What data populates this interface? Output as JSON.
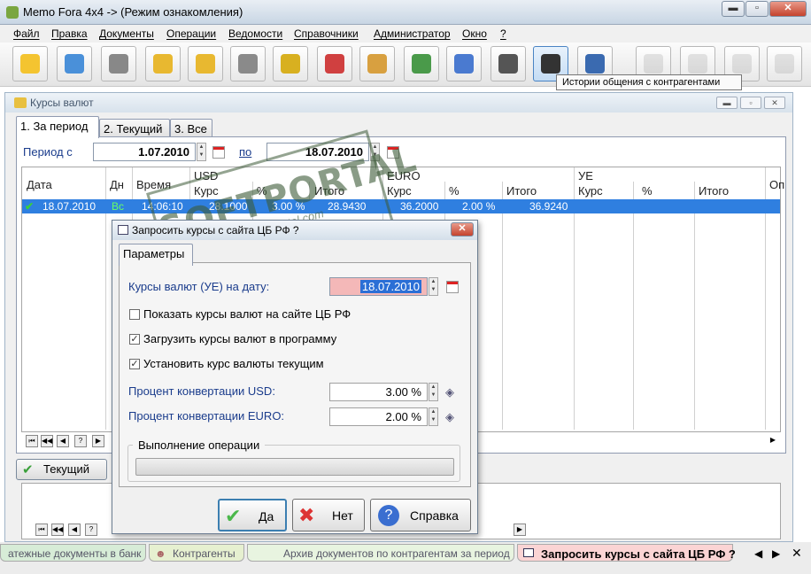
{
  "window": {
    "title": "Memo Fora 4x4 -> (Режим ознакомления)",
    "min": "▬",
    "max": "▫",
    "close": "✕"
  },
  "menu": [
    "Файл",
    "Правка",
    "Документы",
    "Операции",
    "Ведомости",
    "Справочники",
    "Администратор",
    "Окно",
    "?"
  ],
  "toolbar": {
    "icons": [
      "note-pen-icon",
      "card-icon",
      "printer-register-icon",
      "add-folder-icon",
      "import-folder-icon",
      "download-document-icon",
      "forklift-icon",
      "contractors-users-icon",
      "box-icon",
      "presentation-icon",
      "bar-chart-icon",
      "binoculars-icon",
      "headset-icon",
      "phone-note-icon",
      "gray-tool-1-icon",
      "gray-tool-2-icon",
      "gray-tool-3-icon",
      "gray-tool-4-icon"
    ],
    "tooltip": "Истории общения с контрагентами",
    "colors": [
      "#f4c430",
      "#4a90d9",
      "#888888",
      "#e8b830",
      "#e8b830",
      "#8a8a8a",
      "#d8b020",
      "#d04040",
      "#d8a040",
      "#4a9a4a",
      "#4a7ad0",
      "#555555",
      "#333333",
      "#3a6ab0",
      "#999999",
      "#999999",
      "#999999",
      "#999999"
    ]
  },
  "child": {
    "title": "Курсы валют",
    "tabs": [
      "1. За период",
      "2. Текущий",
      "3. Все"
    ],
    "period": {
      "from_label": "Период с",
      "from": "1.07.2010",
      "to_label": "по",
      "to": "18.07.2010"
    },
    "headers": {
      "date": "Дата",
      "day": "Дн",
      "time": "Время",
      "usd": "USD",
      "euro": "EURO",
      "ue": "УЕ",
      "rate": "Курс",
      "pct": "%",
      "total": "Итого",
      "op": "Оп"
    },
    "row": {
      "date": "18.07.2010",
      "day": "Вс",
      "time": "14:06:10",
      "usd_rate": "28.1000",
      "usd_pct": "3.00 %",
      "usd_total": "28.9430",
      "eur_rate": "36.2000",
      "eur_pct": "2.00 %",
      "eur_total": "36.9240"
    },
    "current_button": "Текущий"
  },
  "dialog": {
    "title": "Запросить курсы с сайта ЦБ РФ ?",
    "tab": "Параметры",
    "date_label": "Курсы валют (УЕ) на дату:",
    "date": "18.07.2010",
    "checks": [
      {
        "label": "Показать курсы валют на сайте ЦБ РФ",
        "checked": false
      },
      {
        "label": "Загрузить курсы валют в программу",
        "checked": true
      },
      {
        "label": "Установить курс валюты текущим",
        "checked": true
      }
    ],
    "usd_label": "Процент конвертации USD:",
    "usd_pct": "3.00 %",
    "eur_label": "Процент конвертации EURO:",
    "eur_pct": "2.00 %",
    "progress_label": "Выполнение операции",
    "progress": 0,
    "buttons": {
      "yes": "Да",
      "no": "Нет",
      "help": "Справка"
    }
  },
  "watermark": {
    "brand": "SOFTPORTAL",
    "url": "www.softportal.com",
    "tm": "TM"
  },
  "statusbar": [
    "атежные документы в банк",
    "Контрагенты",
    "Архив документов по контрагентам за период",
    "Запросить курсы с сайта ЦБ РФ ?"
  ]
}
